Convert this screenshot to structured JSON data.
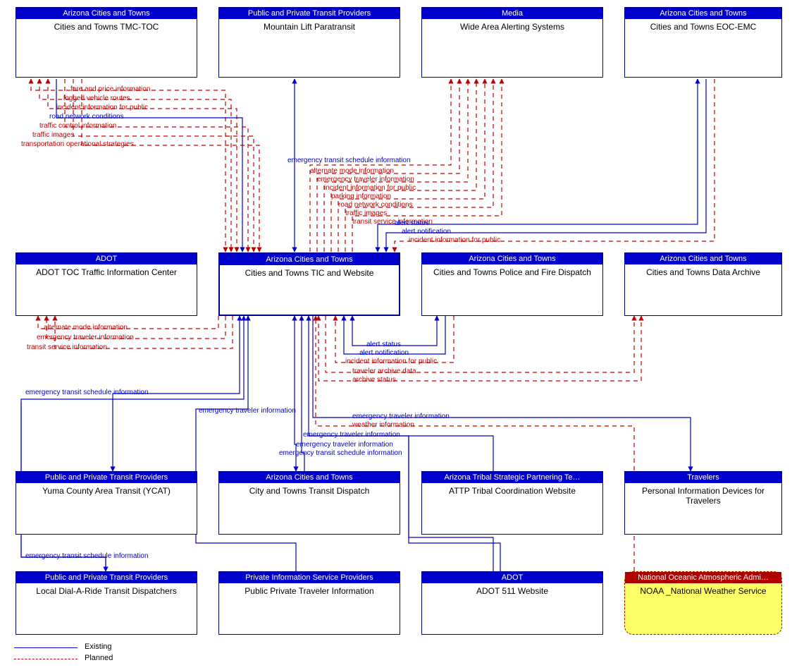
{
  "boxes": {
    "tmc": {
      "hdr": "Arizona Cities and Towns",
      "body": "Cities and Towns TMC-TOC"
    },
    "mountain": {
      "hdr": "Public and Private Transit Providers",
      "body": "Mountain Lift Paratransit"
    },
    "media": {
      "hdr": "Media",
      "body": "Wide Area Alerting Systems"
    },
    "eoc": {
      "hdr": "Arizona Cities and Towns",
      "body": "Cities and Towns EOC-EMC"
    },
    "adot_tic": {
      "hdr": "ADOT",
      "body": "ADOT TOC Traffic Information Center"
    },
    "center": {
      "hdr": "Arizona Cities and Towns",
      "body": "Cities and Towns TIC and Website"
    },
    "police": {
      "hdr": "Arizona Cities and Towns",
      "body": "Cities and Towns Police and Fire Dispatch"
    },
    "archive": {
      "hdr": "Arizona Cities and Towns",
      "body": "Cities and Towns Data Archive"
    },
    "ycat": {
      "hdr": "Public and Private Transit Providers",
      "body": "Yuma County Area Transit (YCAT)"
    },
    "city_td": {
      "hdr": "Arizona Cities and Towns",
      "body": "City and Towns Transit Dispatch"
    },
    "attp": {
      "hdr": "Arizona Tribal Strategic Partnering Te…",
      "body": "ATTP Tribal Coordination Website"
    },
    "pidt": {
      "hdr": "Travelers",
      "body": "Personal Information Devices for Travelers"
    },
    "dial": {
      "hdr": "Public and Private Transit Providers",
      "body": "Local Dial-A-Ride Transit Dispatchers"
    },
    "private": {
      "hdr": "Private Information Service Providers",
      "body": "Public  Private Traveler Information"
    },
    "adot511": {
      "hdr": "ADOT",
      "body": "ADOT 511 Website"
    },
    "noaa": {
      "hdr": "National Oceanic Atmospheric Admi…",
      "body": "NOAA _National Weather Service"
    }
  },
  "flows": {
    "tmc_to_center": {
      "fare_price": "fare and price information",
      "logged_routes": "logged vehicle routes",
      "incident_public": "incident information for public",
      "road_network": "road network conditions",
      "traffic_control": "traffic control information",
      "traffic_images": "traffic images",
      "trans_ops": "transportation operational strategies"
    },
    "mountain_to_center": {
      "emerg_transit": "emergency transit schedule information"
    },
    "center_to_media": {
      "alt_mode": "alternate mode information",
      "emerg_traveler": "emergency traveler information",
      "incident_public": "incident information for public",
      "parking": "parking information",
      "road_network": "road network conditions",
      "traffic_images": "traffic images",
      "transit_svc": "transit service information"
    },
    "eoc_center": {
      "alert_status": "alert status",
      "alert_notif": "alert notification",
      "incident_public": "incident information for public"
    },
    "center_to_adot": {
      "alt_mode": "alternate mode information",
      "emerg_traveler": "emergency traveler information",
      "transit_svc": "transit service information"
    },
    "police_center": {
      "alert_status": "alert status",
      "alert_notif": "alert notification",
      "incident_public": "incident information for public"
    },
    "center_archive": {
      "traveler_archive": "traveler archive data",
      "archive_status": "archive status"
    },
    "ycat_center": {
      "emerg_transit": "emergency transit schedule information"
    },
    "private_center": {
      "emerg_traveler": "emergency traveler information"
    },
    "attp_pidt": {
      "emerg_traveler_out": "emergency traveler information",
      "weather": "weather information",
      "emerg_traveler_in": "emergency traveler information"
    },
    "city_td_center": {
      "emerg_traveler": "emergency traveler information",
      "emerg_transit": "emergency transit schedule information"
    },
    "dial_center": {
      "emerg_transit": "emergency transit schedule information"
    }
  },
  "legend": {
    "existing": "Existing",
    "planned": "Planned"
  }
}
